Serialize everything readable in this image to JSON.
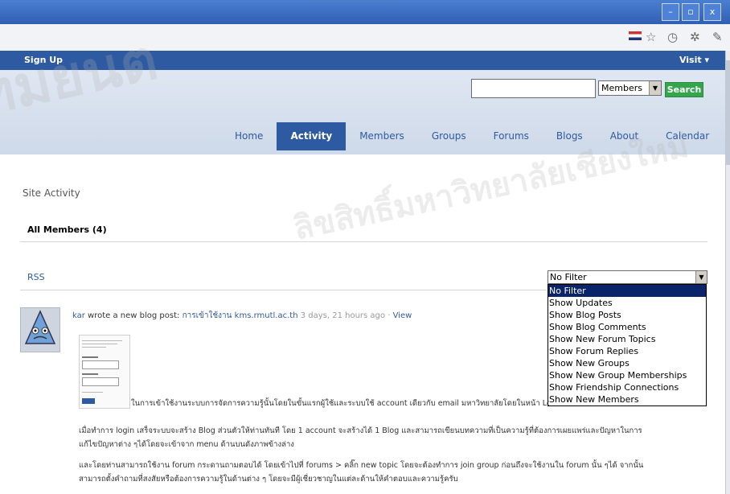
{
  "window": {
    "minimize": "–",
    "maximize": "▫",
    "close": "x"
  },
  "toolbar_icons": [
    "flag-icon",
    "star-icon",
    "clock-icon",
    "gear-icon",
    "wrench-icon"
  ],
  "admin_bar": {
    "signup": "Sign Up",
    "visit": "Visit ▾"
  },
  "header": {
    "search_placeholder": "",
    "search_scope": "Members",
    "search_button": "Search"
  },
  "nav": {
    "items": [
      "Home",
      "Activity",
      "Members",
      "Groups",
      "Forums",
      "Blogs",
      "About",
      "Calendar"
    ],
    "active": "Activity"
  },
  "content": {
    "page_title": "Site Activity",
    "tab_all_members": "All Members (4)",
    "rss": "RSS",
    "filter_selected": "No Filter",
    "filter_options": [
      "No Filter",
      "Show Updates",
      "Show Blog Posts",
      "Show Blog Comments",
      "Show New Forum Topics",
      "Show Forum Replies",
      "Show New Groups",
      "Show New Group Memberships",
      "Show Friendship Connections",
      "Show New Members"
    ]
  },
  "activity": {
    "user": "kar",
    "action": " wrote a new blog post: ",
    "post_title": "การเข้าใช้งาน kms.rmutl.ac.th",
    "time": " 3 days, 21 hours ago · ",
    "view": "View",
    "para1": "ในการเข้าใช้งานระบบการจัดการความรู้นั้นโดยในขั้นแรกผู้ใช้และระบบใช้ account เดียวกับ email มหาวิทยาลัยโดยในหน้า Login หน้าแรก",
    "para2_line1": "เมื่อทำการ login เสร็จระบบจะสร้าง Blog ส่วนตัวให้ท่านทันที โดย 1 account จะสร้างได้ 1 Blog และสามารถเขียนบทความที่เป็นความรู้ที่ต้องการเผยแพร่และปัญหาในการ",
    "para2_line2": "แก้ไขปัญหาต่าง ๆได้โดยจะเข้าจาก menu ด้านบนดังภาพข้างล่าง",
    "para3_line1": "และโดยท่านสามารถใช้งาน forum กระดานถามตอบได้ โดยเข้าไปที่ forums > คลิ๊ก new topic โดยจะต้องทำการ join group ก่อนถึงจะใช้งานใน forum นั้น ๆได้ จากนั้น",
    "para3_line2": "สามารถตั้งคำถามที่สงสัยหรือต้องการความรู้ในด้านต่าง ๆ โดยจะมีผู้เชี่ยวชาญในแต่ละด้านให้คำตอบและความรู้ครับ"
  },
  "watermark": {
    "line1": "ลิขสิทธิ์มหาวิทยาลัยเชียงใหม่",
    "line2": "ทมยนต"
  },
  "colors": {
    "brand_blue": "#2e5aa1",
    "header_bg": "#d7e0ee",
    "search_green": "#33a54a",
    "selected_option": "#0a246a"
  }
}
